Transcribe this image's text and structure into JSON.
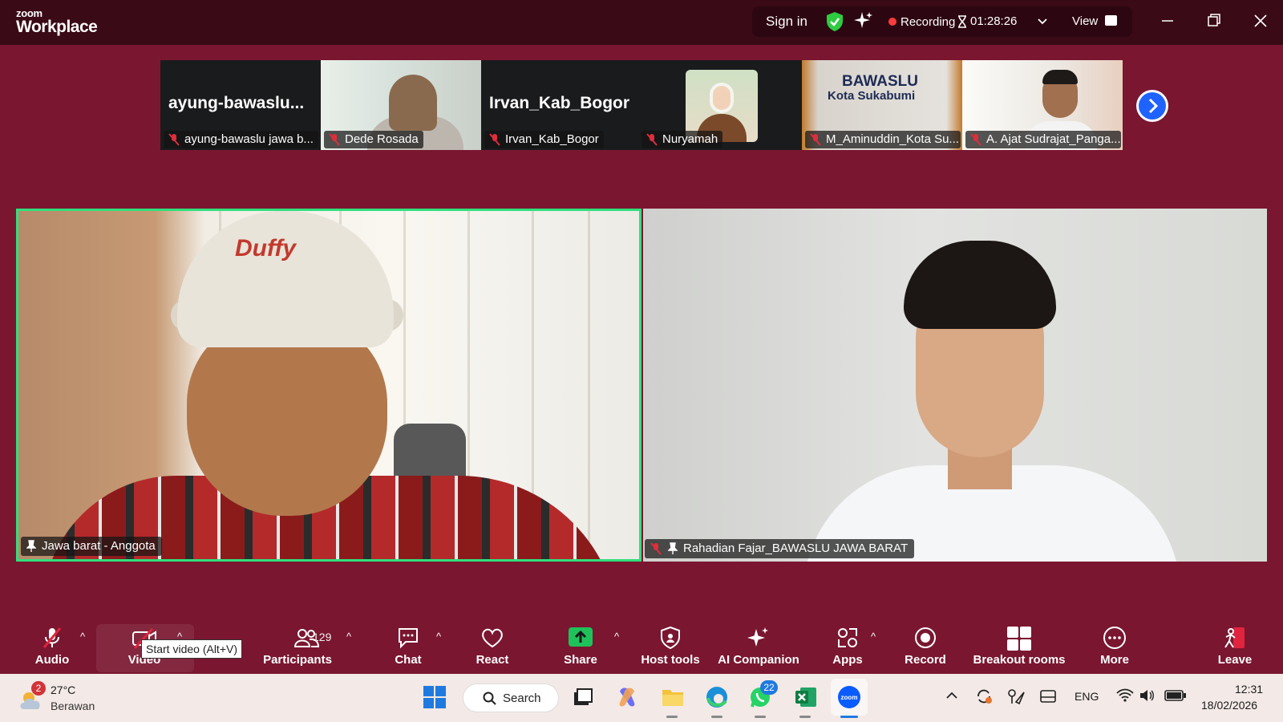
{
  "app": {
    "brand_small": "zoom",
    "brand_big": "Workplace"
  },
  "titlebar": {
    "sign_in": "Sign in",
    "recording": "Recording",
    "timer": "01:28:26",
    "view": "View",
    "icons": [
      "shield-check-icon",
      "sparkle-icon",
      "timer-icon",
      "chevron-down-icon",
      "grid-icon"
    ],
    "colors": {
      "shield": "#2ecc40",
      "recording_dot": "#ff3b3b"
    }
  },
  "filmstrip": [
    {
      "big_name": "ayung-bawaslu...",
      "label": "ayung-bawaslu jawa b..."
    },
    {
      "label": "Dede Rosada"
    },
    {
      "big_name": "Irvan_Kab_Bogor",
      "label": "Irvan_Kab_Bogor"
    },
    {
      "label": "Nuryamah"
    },
    {
      "label": "M_Aminuddin_Kota Su...",
      "sign_line1": "BAWASLU",
      "sign_line2": "Kota Sukabumi"
    },
    {
      "label": "A. Ajat Sudrajat_Panga..."
    }
  ],
  "main_videos": {
    "left": {
      "label": "Jawa barat - Anggota",
      "cap_logo": "Duffy"
    },
    "right": {
      "label": "Rahadian Fajar_BAWASLU JAWA BARAT"
    },
    "active_speaker_color": "#2fe07c"
  },
  "toolbar": {
    "audio": "Audio",
    "video": "Video",
    "video_tooltip": "Start video (Alt+V)",
    "participants": "Participants",
    "participants_count": "129",
    "chat": "Chat",
    "react": "React",
    "share": "Share",
    "host_tools": "Host tools",
    "ai_companion": "AI Companion",
    "apps": "Apps",
    "record": "Record",
    "breakout_rooms": "Breakout rooms",
    "more": "More",
    "leave": "Leave",
    "colors": {
      "share": "#1fc15b",
      "leave": "#e0243e"
    }
  },
  "taskbar": {
    "weather_badge": "2",
    "weather_temp": "27°C",
    "weather_desc": "Berawan",
    "search": "Search",
    "whatsapp_badge": "22",
    "lang": "ENG",
    "time": "12:31",
    "date": "18/02/2026"
  }
}
